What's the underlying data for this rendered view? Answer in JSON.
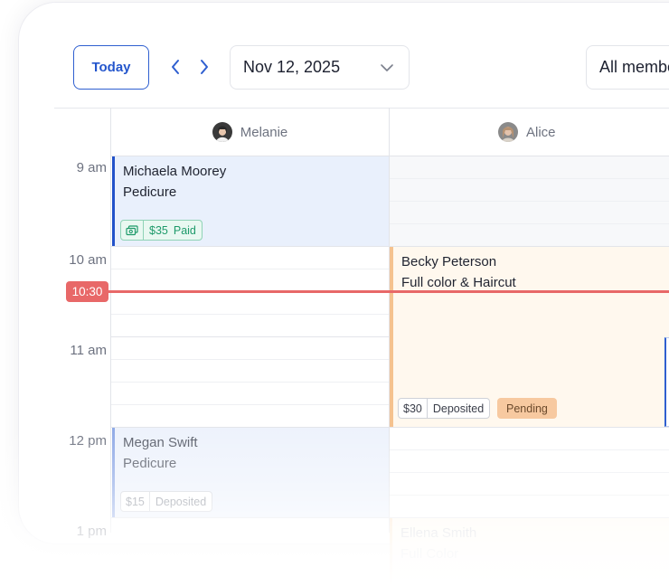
{
  "toolbar": {
    "today_label": "Today",
    "date_value": "Nov 12, 2025",
    "member_filter_value": "All members"
  },
  "columns": [
    {
      "name": "Melanie"
    },
    {
      "name": "Alice"
    }
  ],
  "time_labels": [
    "9 am",
    "10 am",
    "11 am",
    "12 pm",
    "1 pm"
  ],
  "current_time": "10:30",
  "appointments": [
    {
      "client": "Michaela Moorey",
      "service": "Pedicure",
      "price": "$35",
      "payment_status": "Paid"
    },
    {
      "client": "Becky Peterson",
      "service": "Full color & Haircut",
      "price": "$30",
      "payment_status": "Deposited",
      "status": "Pending"
    },
    {
      "client": "Megan Swift",
      "service": "Pedicure",
      "price": "$15",
      "payment_status": "Deposited"
    },
    {
      "client": "Ellena Smith",
      "service": "Full Color"
    }
  ],
  "colors": {
    "accent_blue": "#2456cc",
    "paid_green": "#1e9a6a",
    "now_red": "#e86868",
    "pending_orange": "#f7c9a0"
  }
}
